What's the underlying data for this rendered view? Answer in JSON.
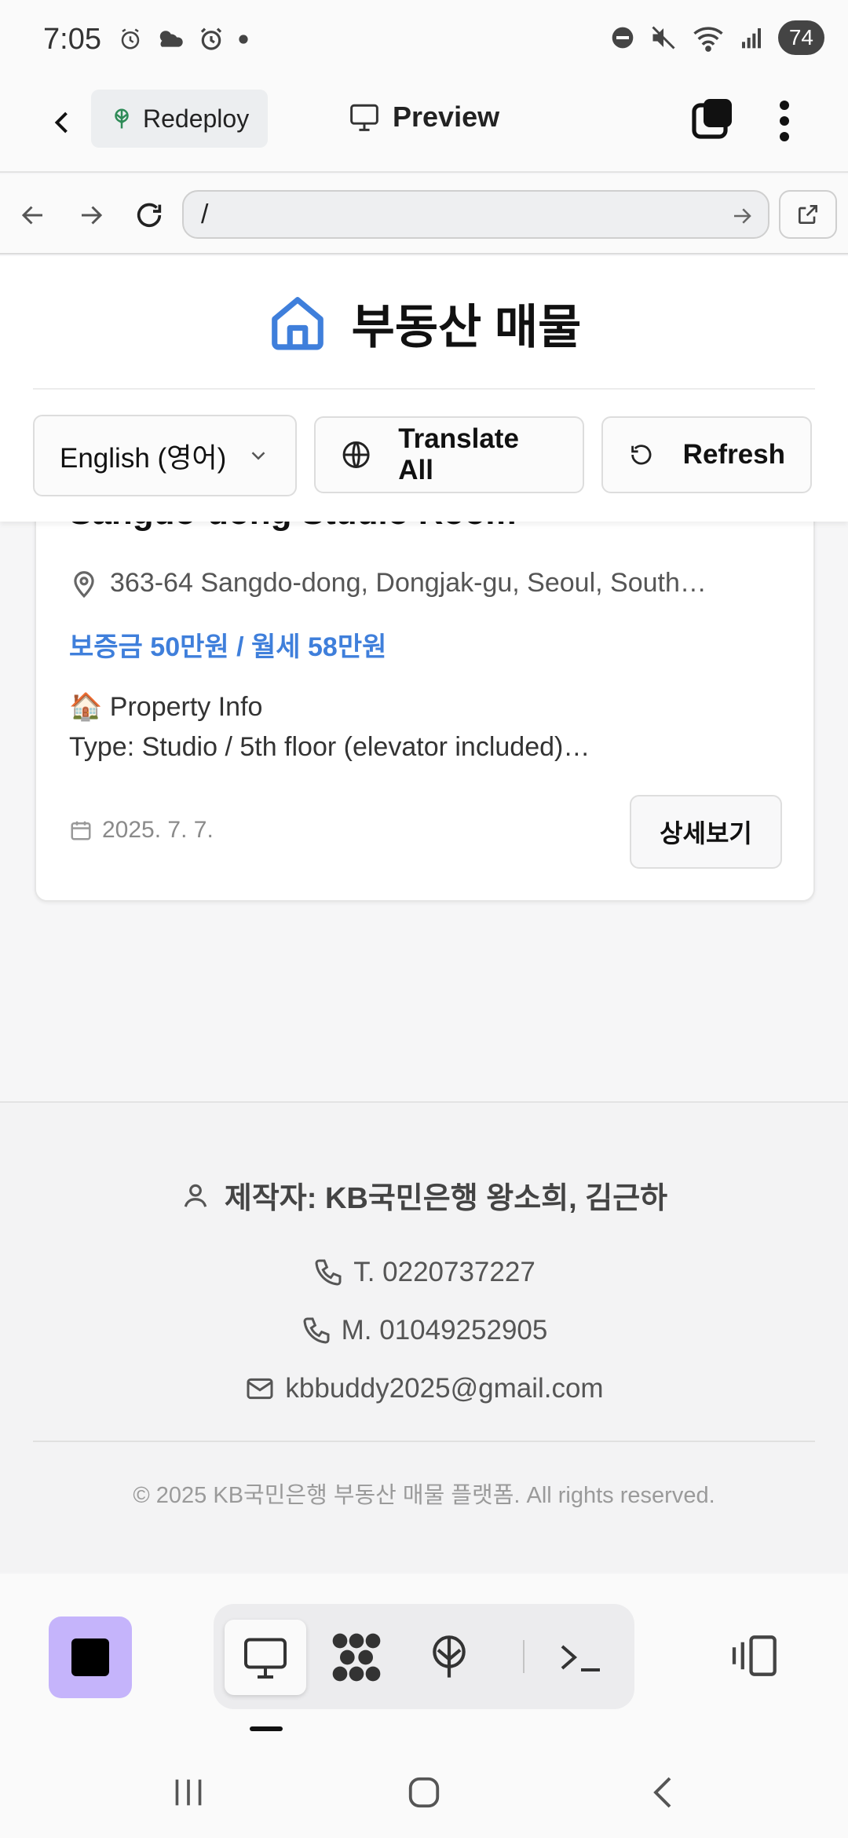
{
  "status_bar": {
    "time": "7:05",
    "battery": "74"
  },
  "app_header": {
    "redeploy_label": "Redeploy",
    "preview_label": "Preview"
  },
  "url_bar": {
    "url": "/"
  },
  "page": {
    "title": "부동산 매물",
    "language_select": "English (영어)",
    "translate_all": "Translate All",
    "refresh": "Refresh"
  },
  "listing": {
    "title": "Sangdo-dong Studio Room",
    "address": "363-64 Sangdo-dong, Dongjak-gu, Seoul, South…",
    "price": "보증금 50만원 / 월세 58만원",
    "info_head": "🏠 Property Info",
    "info_body": "Type: Studio / 5th floor (elevator included)…",
    "date": "2025. 7. 7.",
    "detail_button": "상세보기"
  },
  "footer": {
    "author": "제작자: KB국민은행 왕소희, 김근하",
    "phone": "T. 0220737227",
    "mobile": "M. 01049252905",
    "email": "kbbuddy2025@gmail.com",
    "copyright": "© 2025 KB국민은행 부동산 매물 플랫폼. All rights reserved."
  },
  "colors": {
    "accent": "#3f7fdb",
    "stop_button": "#c5b4fb",
    "redeploy_icon": "#2e8b57"
  }
}
